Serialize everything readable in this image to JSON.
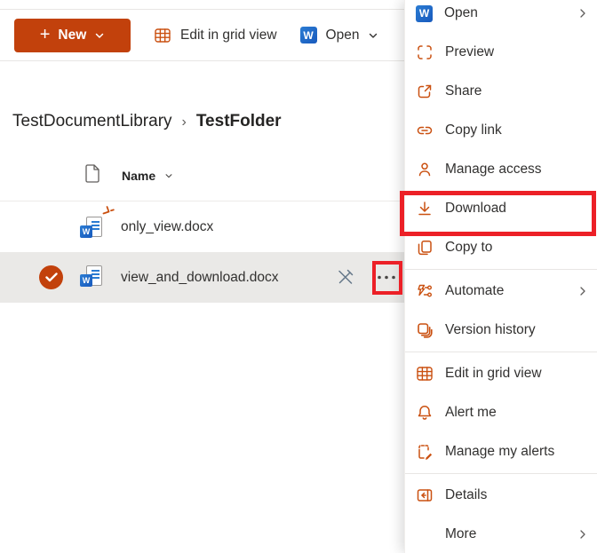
{
  "toolbar": {
    "new_label": "New",
    "edit_in_grid_view_label": "Edit in grid view",
    "open_label": "Open"
  },
  "breadcrumb": {
    "library": "TestDocumentLibrary",
    "separator": "›",
    "current": "TestFolder"
  },
  "table": {
    "name_header": "Name",
    "rows": [
      {
        "name": "only_view.docx",
        "type": "Word document",
        "new_badge": true,
        "selected": false
      },
      {
        "name": "view_and_download.docx",
        "type": "Word document",
        "new_badge": false,
        "selected": true
      }
    ]
  },
  "word_badge_letter": "W",
  "context_menu": {
    "items": [
      {
        "label": "Open",
        "icon": "word-logo",
        "has_submenu": true
      },
      {
        "label": "Preview",
        "icon": "preview-icon"
      },
      {
        "label": "Share",
        "icon": "share-icon"
      },
      {
        "label": "Copy link",
        "icon": "link-icon"
      },
      {
        "label": "Manage access",
        "icon": "person-icon"
      },
      {
        "label": "Download",
        "icon": "download-icon",
        "highlighted": true
      },
      {
        "label": "Copy to",
        "icon": "copy-icon"
      },
      {
        "divider": true
      },
      {
        "label": "Automate",
        "icon": "automate-icon",
        "has_submenu": true
      },
      {
        "label": "Version history",
        "icon": "history-icon"
      },
      {
        "divider": true
      },
      {
        "label": "Edit in grid view",
        "icon": "grid-icon"
      },
      {
        "label": "Alert me",
        "icon": "bell-icon"
      },
      {
        "label": "Manage my alerts",
        "icon": "alerts-icon"
      },
      {
        "divider": true
      },
      {
        "label": "Details",
        "icon": "details-icon"
      },
      {
        "label": "More",
        "icon": null,
        "has_submenu": true
      }
    ]
  },
  "annotations": {
    "highlight_color": "#EC2027",
    "highlighted_elements": [
      "Download menu item",
      "selected row ellipsis button"
    ]
  },
  "colors": {
    "accent_orange": "#CA5010",
    "button_orange": "#C2410C",
    "selected_row_bg": "#EAE9E7",
    "word_blue": "#185ABD",
    "annotation_red": "#EC2027"
  }
}
